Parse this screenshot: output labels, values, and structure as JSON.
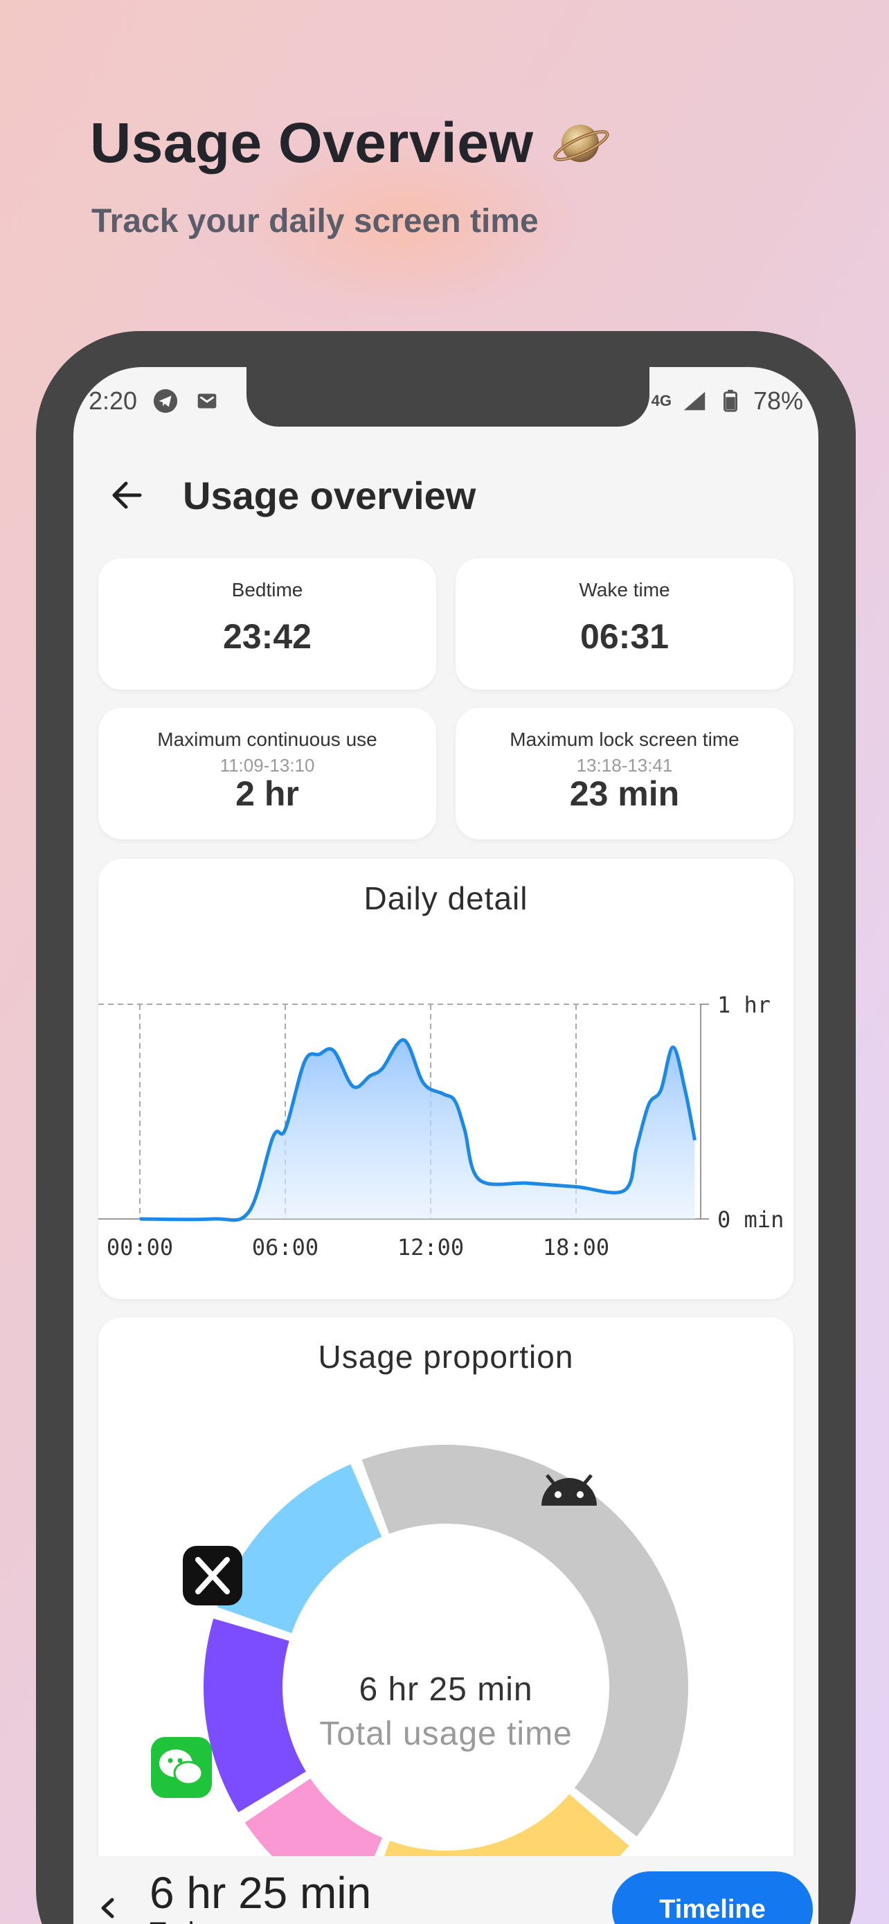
{
  "hero": {
    "title": "Usage Overview",
    "subtitle": "Track your daily screen time",
    "emoji_icon": "planet-icon"
  },
  "status_bar": {
    "time": "2:20",
    "left_icons": [
      "telegram-icon",
      "mail-icon"
    ],
    "network": "4G",
    "battery": "78%"
  },
  "appbar": {
    "title": "Usage overview"
  },
  "stats": {
    "bedtime": {
      "label": "Bedtime",
      "value": "23:42"
    },
    "wake_time": {
      "label": "Wake time",
      "value": "06:31"
    },
    "max_continuous": {
      "label": "Maximum continuous use",
      "range": "11:09-13:10",
      "value": "2 hr"
    },
    "max_lock": {
      "label": "Maximum lock screen time",
      "range": "13:18-13:41",
      "value": "23 min"
    }
  },
  "daily_detail": {
    "title": "Daily detail"
  },
  "chart_data": [
    {
      "type": "area",
      "title": "Daily detail",
      "x_tick_labels": [
        "00:00",
        "06:00",
        "12:00",
        "18:00"
      ],
      "y_tick_labels": [
        "0 min",
        "1 hr"
      ],
      "ylim": [
        0,
        60
      ],
      "xlim": [
        0,
        23
      ],
      "grid": true,
      "series": [
        {
          "x": [
            0,
            3,
            4.5,
            5.5,
            6,
            6.8,
            7.4,
            8,
            8.8,
            9.5,
            10,
            10.9,
            11.7,
            12.5,
            13,
            13.4,
            14,
            16,
            18,
            20,
            20.5,
            21,
            21.5,
            22,
            22.5,
            22.9
          ],
          "y": [
            0,
            0,
            2,
            23,
            25,
            44,
            46,
            47,
            37,
            40,
            42,
            50,
            38,
            35,
            33,
            25,
            11,
            10,
            9,
            8,
            20,
            32,
            36,
            48,
            36,
            22
          ]
        }
      ],
      "color": "#1e88e5"
    },
    {
      "type": "pie",
      "title": "Usage proportion",
      "center_value": "6 hr 25 min",
      "center_label": "Total usage time",
      "slices": [
        {
          "icon": "android-icon",
          "value": 42,
          "color": "#c8c8c8"
        },
        {
          "icon": "app-icon",
          "value": 20,
          "color": "#ffd66e"
        },
        {
          "icon": "app-icon",
          "value": 10,
          "color": "#f998d3"
        },
        {
          "icon": "wechat-icon",
          "value": 14,
          "color": "#7c4dff"
        },
        {
          "icon": "x-icon",
          "value": 14,
          "color": "#7dcfff"
        }
      ]
    }
  ],
  "usage_proportion": {
    "title": "Usage proportion",
    "center_value": "6 hr 25 min",
    "center_label": "Total usage time"
  },
  "bottom_bar": {
    "total": "6 hr 25 min",
    "day": "Today",
    "timeline_label": "Timeline"
  },
  "colors": {
    "accent": "#1479f0",
    "chart_line": "#1e88e5"
  }
}
